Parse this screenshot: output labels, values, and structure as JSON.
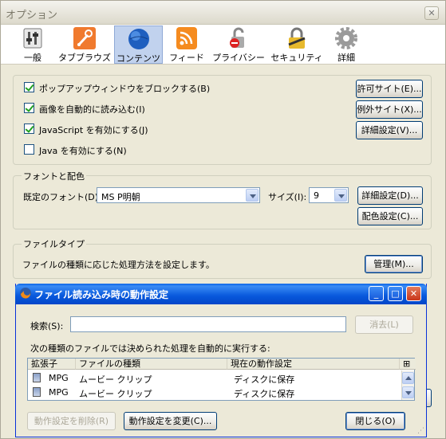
{
  "window": {
    "title": "オプション",
    "close": "✕"
  },
  "toolbar": {
    "items": [
      {
        "label": "一般",
        "icon": "general-switch-icon"
      },
      {
        "label": "タブブラウズ",
        "icon": "tabs-wrench-icon"
      },
      {
        "label": "コンテンツ",
        "icon": "globe-icon",
        "selected": true
      },
      {
        "label": "フィード",
        "icon": "rss-feed-icon"
      },
      {
        "label": "プライバシー",
        "icon": "privacy-lock-icon"
      },
      {
        "label": "セキュリティ",
        "icon": "security-padlock-icon"
      },
      {
        "label": "詳細",
        "icon": "gear-icon"
      }
    ]
  },
  "content": {
    "popup": {
      "label": "ポップアップウィンドウをブロックする(B)",
      "checked": true
    },
    "images": {
      "label": "画像を自動的に読み込む(I)",
      "checked": true
    },
    "javascript": {
      "label": "JavaScript を有効にする(J)",
      "checked": true
    },
    "java": {
      "label": "Java を有効にする(N)",
      "checked": false
    },
    "allowed_sites_btn": "許可サイト(E)...",
    "exceptions_btn": "例外サイト(X)...",
    "advanced_btn": "詳細設定(V)..."
  },
  "fonts": {
    "title": "フォントと配色",
    "default_font_label": "既定のフォント(D):",
    "default_font_value": "MS P明朝",
    "size_label": "サイズ(I):",
    "size_value": "9",
    "advanced_btn": "詳細設定(D)...",
    "colors_btn": "配色設定(C)..."
  },
  "filetypes": {
    "title": "ファイルタイプ",
    "desc": "ファイルの種類に応じた処理方法を設定します。",
    "manage_btn": "管理(M)..."
  },
  "dialog": {
    "title": "ファイル読み込み時の動作設定",
    "search_label": "検索(S):",
    "search_value": "",
    "clear_btn": "消去(L)",
    "desc": "次の種類のファイルでは決められた処理を自動的に実行する:",
    "columns": [
      "拡張子",
      "ファイルの種類",
      "現在の動作設定"
    ],
    "rows": [
      {
        "ext": "MPG",
        "type": "ムービー クリップ",
        "action": "ディスクに保存"
      },
      {
        "ext": "MPG",
        "type": "ムービー クリップ",
        "action": "ディスクに保存"
      }
    ],
    "remove_btn": "動作設定を削除(R)",
    "change_btn": "動作設定を変更(C)...",
    "close_btn": "閉じる(O)",
    "min": "_",
    "max": "□",
    "x": "✕"
  }
}
